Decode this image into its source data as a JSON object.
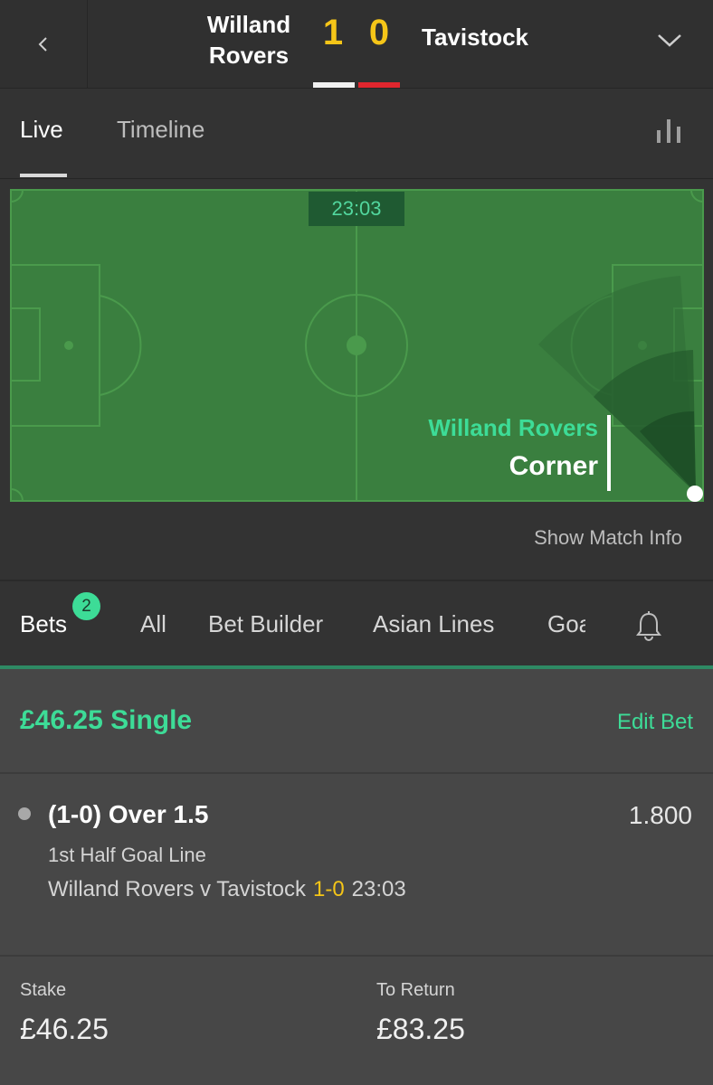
{
  "header": {
    "home_team": "Willand Rovers",
    "away_team": "Tavistock",
    "home_score": "1",
    "away_score": "0"
  },
  "match_tabs": {
    "live": "Live",
    "timeline": "Timeline"
  },
  "pitch": {
    "clock": "23:03",
    "event_team": "Willand Rovers",
    "event_type": "Corner"
  },
  "show_match_info": "Show Match Info",
  "bet_tabs": {
    "bets": "Bets",
    "bets_count": "2",
    "all": "All",
    "bet_builder": "Bet Builder",
    "asian_lines": "Asian Lines",
    "goals_truncated": "Goa"
  },
  "bet": {
    "title": "£46.25 Single",
    "edit": "Edit Bet",
    "selection": "(1-0) Over 1.5",
    "odds": "1.800",
    "market": "1st Half Goal Line",
    "fixture": "Willand Rovers v Tavistock",
    "live_score": "1-0",
    "live_time": "23:03",
    "stake_label": "Stake",
    "stake_value": "£46.25",
    "return_label": "To Return",
    "return_value": "£83.25"
  },
  "colors": {
    "accent_green": "#3ddc97",
    "score_yellow": "#f5c518",
    "away_red": "#e0262e",
    "pitch_green": "#3a7f3f"
  }
}
